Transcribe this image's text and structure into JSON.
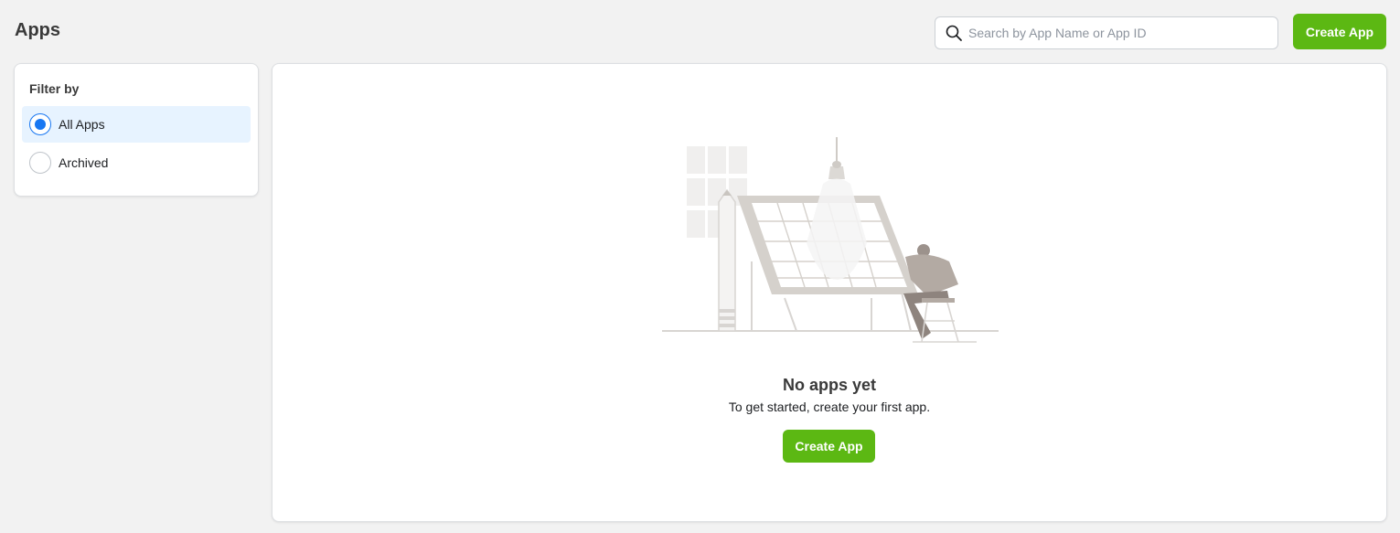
{
  "header": {
    "title": "Apps",
    "search_placeholder": "Search by App Name or App ID",
    "search_value": "",
    "create_button_label": "Create App"
  },
  "filter": {
    "title": "Filter by",
    "options": [
      {
        "label": "All Apps",
        "selected": true
      },
      {
        "label": "Archived",
        "selected": false
      }
    ]
  },
  "empty_state": {
    "title": "No apps yet",
    "subtitle": "To get started, create your first app.",
    "button_label": "Create App"
  },
  "colors": {
    "accent_green": "#5cb813",
    "selected_blue": "#1877f2",
    "selected_bg": "#e7f3ff",
    "page_bg": "#f2f2f2"
  },
  "icons": {
    "search": "search-icon",
    "illustration": "empty-state-illustration"
  }
}
